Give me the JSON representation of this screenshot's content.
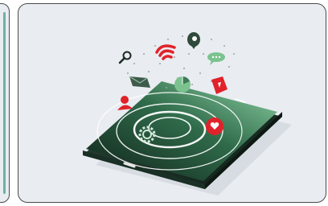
{
  "illustration": {
    "subject": "smartphone-with-floating-app-icons",
    "icons": [
      "search-icon",
      "wifi-icon",
      "location-pin-icon",
      "chat-bubble-icon",
      "mail-icon",
      "pie-chart-icon",
      "bookmark-icon",
      "user-icon",
      "heart-icon",
      "gear-icon"
    ],
    "colors": {
      "card_bg": "#e9ecf1",
      "card_border": "#4a4a4a",
      "phone_body": "#1e3a2e",
      "screen_start": "#0f1f18",
      "screen_end": "#7fc79a",
      "accent_red": "#e0222a",
      "accent_green": "#7bc28f",
      "dark_icon": "#2f4a3c"
    }
  }
}
